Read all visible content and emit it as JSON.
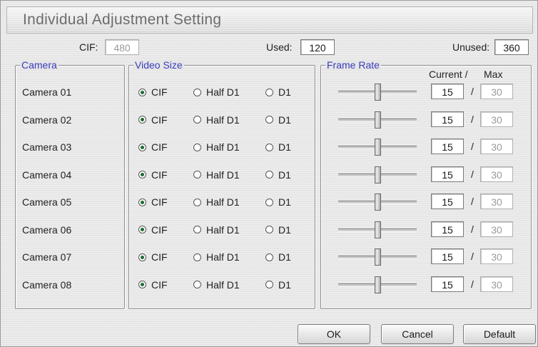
{
  "title": "Individual Adjustment Setting",
  "summary": {
    "cif_label": "CIF:",
    "cif_value": "480",
    "used_label": "Used:",
    "used_value": "120",
    "unused_label": "Unused:",
    "unused_value": "360"
  },
  "groups": {
    "camera": "Camera",
    "video_size": "Video Size",
    "frame_rate": "Frame Rate",
    "current_header": "Current /",
    "max_header": "Max"
  },
  "size_options": [
    "CIF",
    "Half D1",
    "D1"
  ],
  "cameras": [
    {
      "name": "Camera 01",
      "size": "CIF",
      "current": "15",
      "max": "30",
      "level": 0.5
    },
    {
      "name": "Camera 02",
      "size": "CIF",
      "current": "15",
      "max": "30",
      "level": 0.5
    },
    {
      "name": "Camera 03",
      "size": "CIF",
      "current": "15",
      "max": "30",
      "level": 0.5
    },
    {
      "name": "Camera 04",
      "size": "CIF",
      "current": "15",
      "max": "30",
      "level": 0.5
    },
    {
      "name": "Camera 05",
      "size": "CIF",
      "current": "15",
      "max": "30",
      "level": 0.5
    },
    {
      "name": "Camera 06",
      "size": "CIF",
      "current": "15",
      "max": "30",
      "level": 0.5
    },
    {
      "name": "Camera 07",
      "size": "CIF",
      "current": "15",
      "max": "30",
      "level": 0.5
    },
    {
      "name": "Camera 08",
      "size": "CIF",
      "current": "15",
      "max": "30",
      "level": 0.5
    }
  ],
  "slash": "/",
  "buttons": {
    "ok": "OK",
    "cancel": "Cancel",
    "default": "Default"
  },
  "colors": {
    "legend": "#3b3bbd",
    "radio_selected": "#1b6b2e"
  }
}
